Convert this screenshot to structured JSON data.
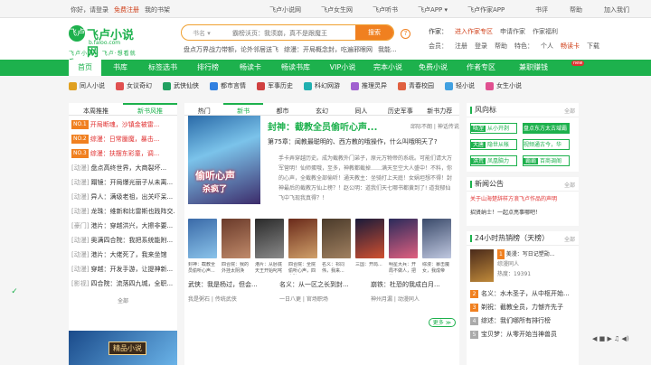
{
  "topbar": {
    "greeting": "你好，请登录",
    "register": "免费注册",
    "bookshelf": "我的书架",
    "center_links": [
      "飞卢小说网",
      "飞卢女生网",
      "飞卢听书",
      "飞卢APP ▾",
      "飞卢作家APP",
      "书评",
      "帮助",
      "加入我们"
    ]
  },
  "header": {
    "logo": {
      "mark": "飞卢",
      "name": "飞卢小说网",
      "domain": "b.faloo.com",
      "slogan": "飞卢小说 · 飞卢·想看就看"
    },
    "search": {
      "type_label": "书名 ▾",
      "placeholder": "霸榜沃页：我须崩，真不是跟魔王",
      "button": "搜索"
    },
    "hot_searches": [
      "盘点万界战力带额，论外邻居送飞",
      "综漫：开局概念封，吃遍邪眼网",
      "我能..."
    ],
    "help_icon": "?",
    "right_row1": {
      "label": "作家：",
      "links": [
        "进入作家专区",
        "申请作家",
        "作家福利"
      ]
    },
    "right_row2": {
      "label": "会员：",
      "links": [
        "注册",
        "登录",
        "帮助",
        "特色：",
        "个人",
        "畅读卡",
        "下载"
      ]
    }
  },
  "nav": {
    "items": [
      "首页",
      "书库",
      "标签选书",
      "排行榜",
      "畅读卡",
      "畅读书库",
      "VIP小说",
      "完本小说",
      "免费小说",
      "作者专区",
      "兼职赚钱"
    ],
    "new_badge": "new"
  },
  "categories": [
    {
      "label": "同人小说",
      "color": "#e0a020"
    },
    {
      "label": "女议奇幻",
      "color": "#e05050"
    },
    {
      "label": "武侠仙侠",
      "color": "#20a060"
    },
    {
      "label": "都市言情",
      "color": "#3080e0"
    },
    {
      "label": "军事历史",
      "color": "#d04040"
    },
    {
      "label": "科幻网游",
      "color": "#20b0b0"
    },
    {
      "label": "推理灵异",
      "color": "#a060d0"
    },
    {
      "label": "青春校园",
      "color": "#e06040"
    },
    {
      "label": "轻小说",
      "color": "#40a0e0"
    },
    {
      "label": "女生小说",
      "color": "#e05090"
    }
  ],
  "left_panel": {
    "tabs": [
      "本周推推",
      "新书风推"
    ],
    "items": [
      {
        "badge": "NO.1",
        "text": "开局断魂，沙镇金被雷..."
      },
      {
        "badge": "NO.2",
        "text": "综漫：日常蜃魔，暴击..."
      },
      {
        "badge": "NO.3",
        "text": "综漫：扶摆东彩童，调..."
      },
      {
        "tag": "[动漫]",
        "text": "盘点高终世界，大商裂坏..."
      },
      {
        "tag": "[动漫]",
        "text": "蹋镜：开局爆光丽子从未离..."
      },
      {
        "tag": "[动漫]",
        "text": "异人：满级老祖，出关吓呆..."
      },
      {
        "tag": "[动漫]",
        "text": "龙珠：维新和比雷斯也践阵交..."
      },
      {
        "tag": "[豪门]",
        "text": "港片：穿越洪兴，大擦非要..."
      },
      {
        "tag": "[动漫]",
        "text": "奥满四合院：我把系统能附..."
      },
      {
        "tag": "[动漫]",
        "text": "港片：大佬死了，我来坐馆"
      },
      {
        "tag": "[动漫]",
        "text": "穿越：开发手游，让提神新..."
      },
      {
        "tag": "[影视]",
        "text": "四合院：流落四九城，全职..."
      }
    ],
    "all": "全部",
    "banner": "精品小说"
  },
  "center_panel": {
    "tabs": [
      "热门",
      "新书",
      "都市",
      "玄幻",
      "同人",
      "历史军事",
      "新书力荐"
    ],
    "featured": {
      "cover_line1": "偷听心声",
      "cover_line2": "杀疯了",
      "title": "封神：截教全员偷听心声...",
      "author": "邱际不朗 | 神话传说",
      "chapter": "第75章：闻教最聪明的、西方教的哦操作，什么叫哦明天了?",
      "desc": "手卡弄穿越历史。成为截教外门弟子，原元万物帝的系统。可能们请大万军营明！仙师蛋哦，至多，神教都截掉……满天至空大人盛中！不料，你的心声，全截教全部偷听！通天教主：坐骑打上天庭！女娲坦想不得！封神最后的截教万仙上榜？！赵公明：道我们天七哪书都黄到了! 道我郁仙飞中飞现我真得？！"
    },
    "covers": [
      {
        "caption": "封神：截教全员偷听心声...",
        "c1": "#3a6aa8",
        "c2": "#8ac3ea"
      },
      {
        "caption": "四合院：我的外挂太阴涣",
        "c1": "#6a3a2a",
        "c2": "#c08a6a"
      },
      {
        "caption": "港片：从卧底天王开始叱咤",
        "c1": "#2a2a2a",
        "c2": "#8a8a8a"
      },
      {
        "caption": "四合院：全院偷听心声，四合院",
        "c1": "#6a2a1a",
        "c2": "#d0a06a"
      },
      {
        "caption": "名义：祁同伟，我来...",
        "c1": "#4a3a2a",
        "c2": "#a08060"
      },
      {
        "caption": "三国：开局...",
        "c1": "#1a1a3a",
        "c2": "#d05030"
      },
      {
        "caption": "明星大兵：开局不做人，把范…",
        "c1": "#2a2a5a",
        "c2": "#e06080"
      },
      {
        "caption": "综漫：暴击魔女，我成帝王…",
        "c1": "#3a4a6a",
        "c2": "#c0c8e0"
      }
    ],
    "books": [
      {
        "title": "武侠：我是杨过，但会...",
        "author": "我是粥石 | 传统武侠"
      },
      {
        "title": "名义：从一区之长到封...",
        "author": "一日八更 | 官场职场"
      },
      {
        "title": "崩铁：杜恐的我成白月...",
        "author": "神州月漏 | 动漫同人"
      }
    ],
    "more": "更多 ≫"
  },
  "right_panel": {
    "wind_title": "风向标",
    "wind_all": "全部",
    "wind": [
      {
        "k": "唔涅",
        "v": "从小开剥"
      },
      {
        "k": "",
        "v": "盘点东方太古域霸"
      },
      {
        "k": "大唐",
        "v": "隐世从帐"
      },
      {
        "k": "",
        "v": "视频通古今，华"
      },
      {
        "k": "洪荒",
        "v": "凤凰脑力"
      },
      {
        "k": "霸霸",
        "v": "百商调阁"
      }
    ],
    "notice_title": "新闻公告",
    "notice_all": "全部",
    "notices": [
      "关于山海楚辞样方浪飞卢作品的声明",
      "招贤纳士！一起点亮事哪吧！"
    ],
    "hot_title": "24小时热销榜（天榜）",
    "hot_all": "全部",
    "hot_first": {
      "n": "1",
      "title": "美漫：写日记塑勋...",
      "sub": "综漫同人",
      "count": "热度：19391"
    },
    "hot_list": [
      {
        "n": "2",
        "text": "名义：水木圣子，从中枢开始..."
      },
      {
        "n": "3",
        "text": "剃祝：截教全员，力憾齐先子"
      },
      {
        "n": "4",
        "text": "综述：我们哪所有排行榜"
      },
      {
        "n": "5",
        "text": "宝贝梦：从零开始当神兽员"
      }
    ]
  },
  "player": "◀ ■ ▶ ♫ ◀)"
}
